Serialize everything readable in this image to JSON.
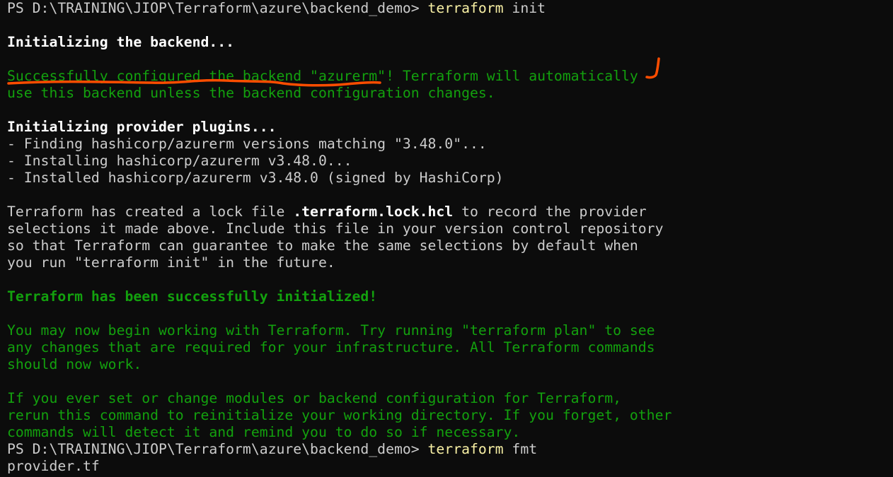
{
  "terminal": {
    "prompt1": {
      "path": "PS D:\\TRAINING\\JIOP\\Terraform\\azure\\backend_demo> ",
      "command": "terraform",
      "args": " init"
    },
    "init_backend": "Initializing the backend...",
    "backend_msg": {
      "highlighted": "Successfully configured the backend \"azurerm\"",
      "rest": "! Terraform will automatically",
      "line2": "use this backend unless the backend configuration changes."
    },
    "init_plugins": "Initializing provider plugins...",
    "plugin_lines": [
      "- Finding hashicorp/azurerm versions matching \"3.48.0\"...",
      "- Installing hashicorp/azurerm v3.48.0...",
      "- Installed hashicorp/azurerm v3.48.0 (signed by HashiCorp)"
    ],
    "lock_msg": {
      "pre": "Terraform has created a lock file ",
      "file": ".terraform.lock.hcl",
      "post": " to record the provider",
      "lines": [
        "selections it made above. Include this file in your version control repository",
        "so that Terraform can guarantee to make the same selections by default when",
        "you run \"terraform init\" in the future."
      ]
    },
    "success": "Terraform has been successfully initialized!",
    "next_steps": [
      "You may now begin working with Terraform. Try running \"terraform plan\" to see",
      "any changes that are required for your infrastructure. All Terraform commands",
      "should now work."
    ],
    "rerun": [
      "If you ever set or change modules or backend configuration for Terraform,",
      "rerun this command to reinitialize your working directory. If you forget, other",
      "commands will detect it and remind you to do so if necessary."
    ],
    "prompt2": {
      "path": "PS D:\\TRAINING\\JIOP\\Terraform\\azure\\backend_demo> ",
      "command": "terraform",
      "args": " fmt"
    },
    "output_file": "provider.tf"
  },
  "colors": {
    "background": "#0c0c0c",
    "text": "#cccccc",
    "bright": "#ffffff",
    "success": "#13a10e",
    "command": "#f9f1a5",
    "annotation": "#ff4d00"
  }
}
